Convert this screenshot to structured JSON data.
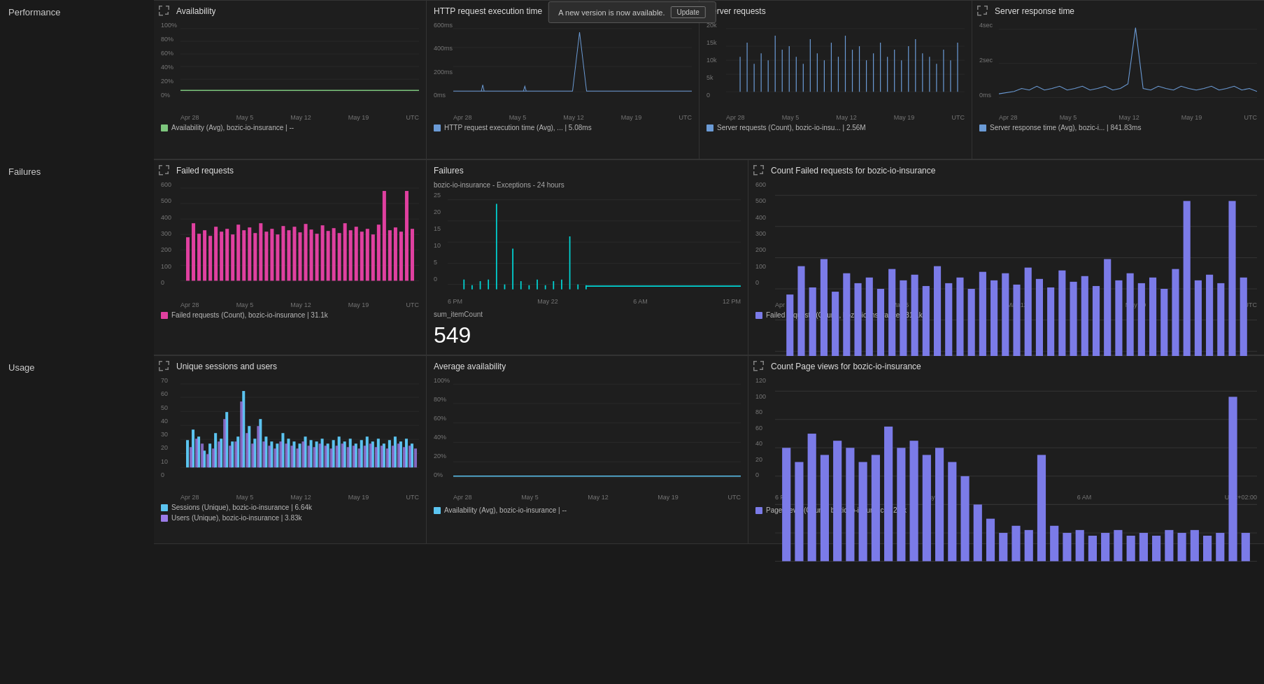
{
  "title": "Performance",
  "toast": {
    "text": "A new version is now available.",
    "button": "Update"
  },
  "sections": {
    "performance": "Performance",
    "failures": "Failures",
    "usage": "Usage"
  },
  "panels": {
    "availability": {
      "title": "Availability",
      "legend": "Availability (Avg), bozic-io-insurance | --",
      "color": "#7dc67d",
      "xLabels": [
        "Apr 28",
        "May 5",
        "May 12",
        "May 19",
        "UTC"
      ],
      "yLabels": [
        "100%",
        "80%",
        "60%",
        "40%",
        "20%",
        "0%"
      ]
    },
    "httpRequest": {
      "title": "HTTP request execution time",
      "legend": "HTTP request execution time (Avg), ... | 5.08ms",
      "color": "#6b9bd6",
      "xLabels": [
        "Apr 28",
        "May 5",
        "May 12",
        "May 19",
        "UTC"
      ],
      "yLabels": [
        "600ms",
        "400ms",
        "200ms",
        "0ms"
      ]
    },
    "serverRequests": {
      "title": "Server requests",
      "legend": "Server requests (Count), bozic-io-insu... | 2.56M",
      "color": "#6b9bd6",
      "xLabels": [
        "Apr 28",
        "May 5",
        "May 12",
        "May 19",
        "UTC"
      ],
      "yLabels": [
        "20k",
        "15k",
        "10k",
        "5k",
        "0"
      ]
    },
    "serverResponseTime": {
      "title": "Server response time",
      "legend": "Server response time (Avg), bozic-i... | 841.83ms",
      "color": "#6b9bd6",
      "xLabels": [
        "Apr 28",
        "May 5",
        "May 12",
        "May 19",
        "UTC"
      ],
      "yLabels": [
        "4sec",
        "2sec",
        "0ms"
      ]
    },
    "failedRequests": {
      "title": "Failed requests",
      "legend": "Failed requests (Count), bozic-io-insurance | 31.1k",
      "color": "#e040a0",
      "xLabels": [
        "Apr 28",
        "May 5",
        "May 12",
        "May 19",
        "UTC"
      ],
      "yLabels": [
        "600",
        "500",
        "400",
        "300",
        "200",
        "100",
        "0"
      ]
    },
    "failures": {
      "title": "Failures",
      "subtitle": "bozic-io-insurance - Exceptions - 24 hours",
      "metric_label": "sum_itemCount",
      "metric_value": "549",
      "xLabels": [
        "6 PM",
        "May 22",
        "6 AM",
        "12 PM"
      ],
      "yLabels": [
        "25",
        "20",
        "15",
        "10",
        "5",
        "0"
      ],
      "color": "#00d4d4"
    },
    "countFailedRequests": {
      "title": "Count Failed requests for bozic-io-insurance",
      "legend": "Failed requests (Count), bozic-io-insurance | 31.1k",
      "color": "#7b7be8",
      "xLabels": [
        "Apr 28",
        "May 5",
        "May 12",
        "May 19",
        "UTC"
      ],
      "yLabels": [
        "600",
        "500",
        "400",
        "300",
        "200",
        "100",
        "0"
      ]
    },
    "uniqueSessions": {
      "title": "Unique sessions and users",
      "legend1": "Sessions (Unique), bozic-io-insurance | 6.64k",
      "legend2": "Users (Unique), bozic-io-insurance | 3.83k",
      "color1": "#5bc4f0",
      "color2": "#9b7be8",
      "xLabels": [
        "Apr 28",
        "May 5",
        "May 12",
        "May 19",
        "UTC"
      ],
      "yLabels": [
        "70",
        "60",
        "50",
        "40",
        "30",
        "20",
        "10",
        "0"
      ]
    },
    "avgAvailability": {
      "title": "Average availability",
      "legend": "Availability (Avg), bozic-io-insurance | --",
      "color": "#5bc4f0",
      "xLabels": [
        "Apr 28",
        "May 5",
        "May 12",
        "May 19",
        "UTC"
      ],
      "yLabels": [
        "100%",
        "80%",
        "60%",
        "40%",
        "20%",
        "0%"
      ]
    },
    "countPageViews": {
      "title": "Count Page views for bozic-io-insurance",
      "legend": "Page views (Count), bozic-io-insurance | 2.1k",
      "color": "#7b7be8",
      "xLabels": [
        "6 PM",
        "May 22",
        "6 AM",
        "UTC+02:00"
      ],
      "yLabels": [
        "120",
        "100",
        "80",
        "60",
        "40",
        "20",
        "0"
      ]
    }
  }
}
